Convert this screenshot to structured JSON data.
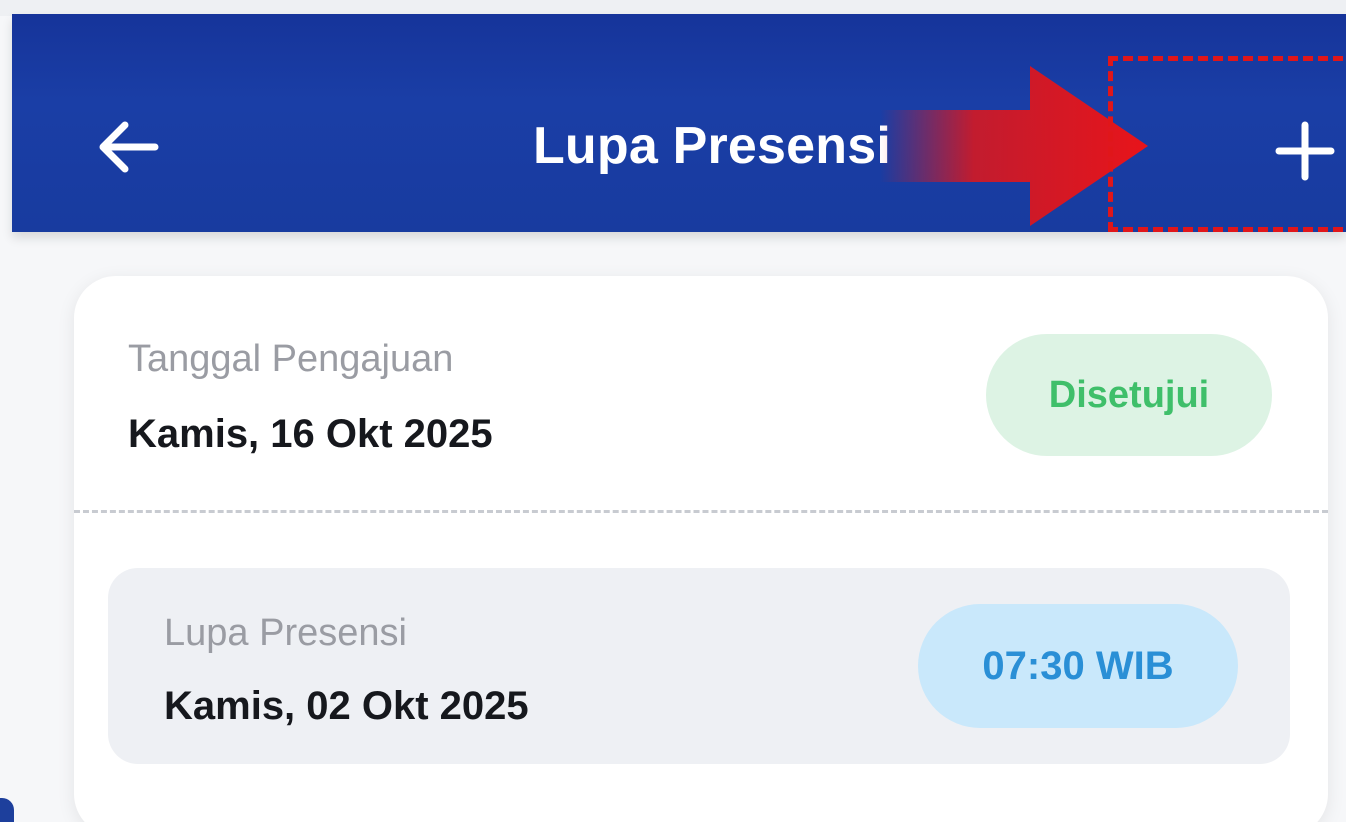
{
  "app_bar": {
    "title": "Lupa Presensi",
    "back_icon": "arrow-left-icon",
    "add_icon": "plus-icon",
    "color": "#1a3ea6"
  },
  "annotation": {
    "arrow_color": "#e0161a",
    "highlight_color": "#e0161a"
  },
  "submission": {
    "date_label": "Tanggal Pengajuan",
    "date_value": "Kamis, 16 Okt 2025",
    "status": "Disetujui",
    "status_color": "#3fbf6a",
    "detail": {
      "type_label": "Lupa Presensi",
      "type_date": "Kamis, 02 Okt 2025",
      "time": "07:30 WIB",
      "time_color": "#2a8fd6"
    }
  }
}
